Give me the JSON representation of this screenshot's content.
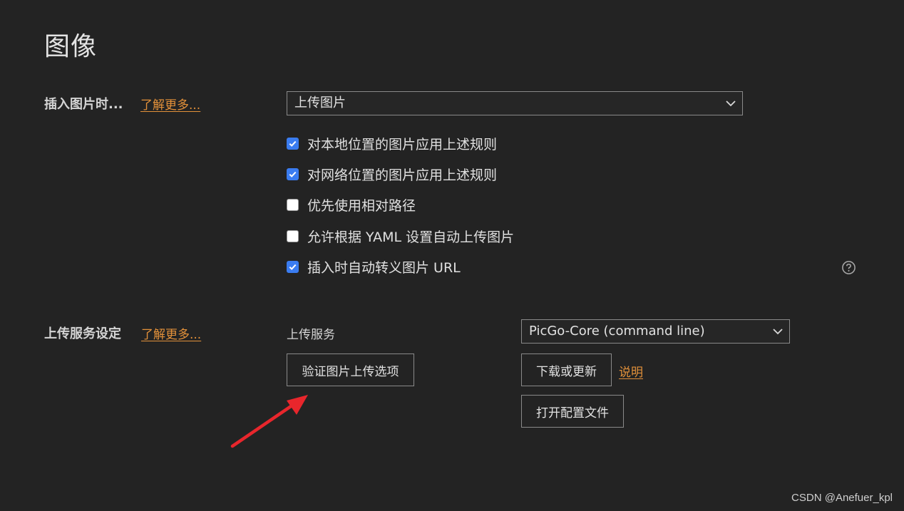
{
  "page": {
    "title": "图像"
  },
  "insert_section": {
    "label": "插入图片时...",
    "learn_more": "了解更多...",
    "select_value": "上传图片",
    "options": [
      {
        "label": "对本地位置的图片应用上述规则",
        "checked": true
      },
      {
        "label": "对网络位置的图片应用上述规则",
        "checked": true
      },
      {
        "label": "优先使用相对路径",
        "checked": false
      },
      {
        "label": "允许根据 YAML 设置自动上传图片",
        "checked": false
      },
      {
        "label": "插入时自动转义图片 URL",
        "checked": true
      }
    ]
  },
  "upload_section": {
    "label": "上传服务设定",
    "learn_more": "了解更多...",
    "service_label": "上传服务",
    "service_value": "PicGo-Core (command line)",
    "verify_button": "验证图片上传选项",
    "download_button": "下载或更新",
    "explain_link": "说明",
    "open_config_button": "打开配置文件"
  },
  "watermark": "CSDN @Anefuer_kpl",
  "colors": {
    "background": "#232323",
    "link": "#e3913a",
    "checkbox_on": "#3a7cf0",
    "annotation_arrow": "#e8262c"
  },
  "icons": {
    "select_chevron": "chevron-down-icon",
    "help": "help-circle-icon",
    "annotation": "red-arrow-icon"
  }
}
